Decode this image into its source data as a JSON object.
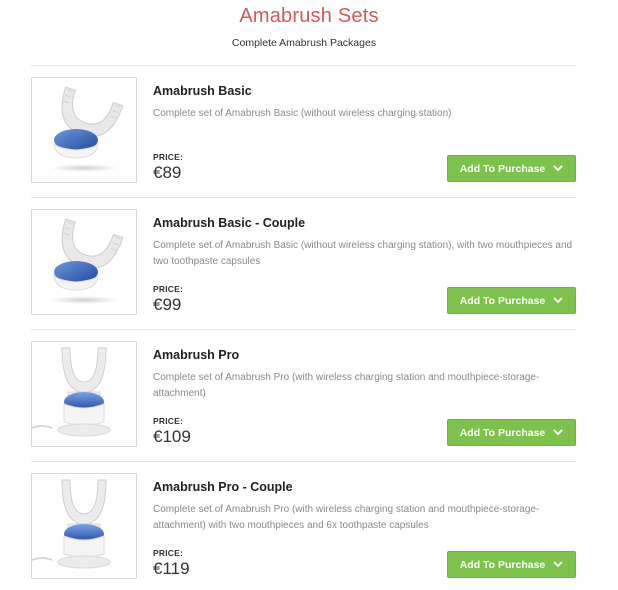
{
  "header": {
    "title": "Amabrush Sets",
    "subtitle": "Complete Amabrush Packages"
  },
  "products": [
    {
      "name": "Amabrush Basic",
      "description": "Complete set of Amabrush Basic (without wireless charging station)",
      "price_label": "PRICE:",
      "price": "€89",
      "button_label": "Add To Purchase",
      "image_variant": "basic"
    },
    {
      "name": "Amabrush Basic - Couple",
      "description": "Complete set of Amabrush Basic (without wireless charging station), with two mouthpieces and two toothpaste capsules",
      "price_label": "PRICE:",
      "price": "€99",
      "button_label": "Add To Purchase",
      "image_variant": "basic"
    },
    {
      "name": "Amabrush Pro",
      "description": "Complete set of Amabrush Pro (with wireless charging station and mouthpiece-storage-attachment)",
      "price_label": "PRICE:",
      "price": "€109",
      "button_label": "Add To Purchase",
      "image_variant": "pro"
    },
    {
      "name": "Amabrush Pro - Couple",
      "description": "Complete set of Amabrush Pro (with wireless charging station and mouthpiece-storage-attachment) with two mouthpieces and 6x toothpaste capsules",
      "price_label": "PRICE:",
      "price": "€119",
      "button_label": "Add To Purchase",
      "image_variant": "pro"
    }
  ],
  "colors": {
    "title": "#d2585c",
    "button": "#7dc24b",
    "brush_blue": "#2f5fb3"
  },
  "icons": {
    "button_icon": "chevron-down-icon",
    "product_image": "amabrush-product-image"
  }
}
